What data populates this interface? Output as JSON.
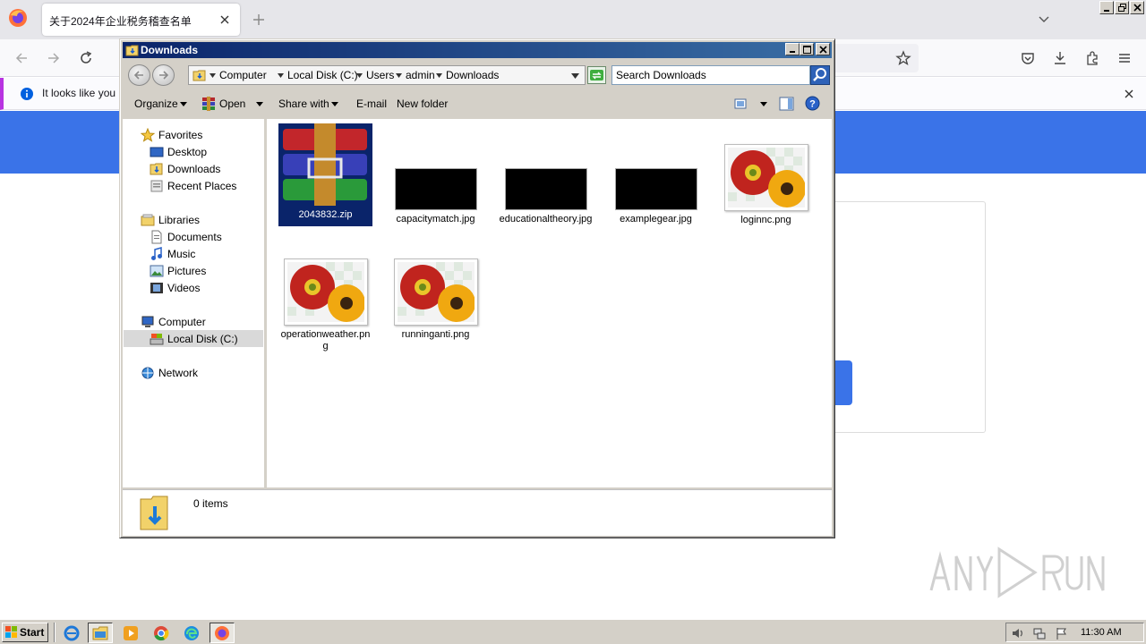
{
  "browser": {
    "tab_title": "关于2024年企业税务稽查名单",
    "notification_text": "It looks like you ha",
    "accent_color": "#3a73e8",
    "notification_bar_color": "#b833e1"
  },
  "explorer": {
    "window_title": "Downloads",
    "breadcrumbs": [
      "Computer",
      "Local Disk (C:)",
      "Users",
      "admin",
      "Downloads"
    ],
    "search_placeholder": "Search Downloads",
    "toolbar": {
      "organize": "Organize",
      "open": "Open",
      "share_with": "Share with",
      "email": "E-mail",
      "new_folder": "New folder"
    },
    "nav": {
      "favorites": "Favorites",
      "desktop": "Desktop",
      "downloads": "Downloads",
      "recent_places": "Recent Places",
      "libraries": "Libraries",
      "documents": "Documents",
      "music": "Music",
      "pictures": "Pictures",
      "videos": "Videos",
      "computer": "Computer",
      "local_disk": "Local Disk (C:)",
      "network": "Network"
    },
    "files": [
      {
        "name": "2043832.zip",
        "type": "zip-archive",
        "selected": true
      },
      {
        "name": "capacitymatch.jpg",
        "type": "black-image"
      },
      {
        "name": "educationaltheory.jpg",
        "type": "black-image"
      },
      {
        "name": "examplegear.jpg",
        "type": "black-image"
      },
      {
        "name": "loginnc.png",
        "type": "flower-image"
      },
      {
        "name": "operationweather.png",
        "type": "flower-image"
      },
      {
        "name": "runninganti.png",
        "type": "flower-image"
      }
    ],
    "status_text": "0 items",
    "selection_color": "#0a246a"
  },
  "taskbar": {
    "start_label": "Start",
    "clock": "11:30 AM"
  },
  "watermark": "ANY RUN"
}
